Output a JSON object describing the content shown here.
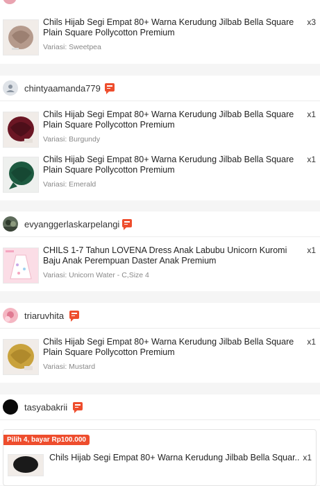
{
  "orders": [
    {
      "items": [
        {
          "title": "Chils Hijab Segi Empat 80+ Warna Kerudung Jilbab Bella Square Plain Square Pollycotton Premium",
          "qty": "x3",
          "variation": "Variasi: Sweetpea"
        }
      ]
    },
    {
      "username": "chintyaamanda779",
      "items": [
        {
          "title": "Chils Hijab Segi Empat 80+ Warna Kerudung Jilbab Bella Square Plain Square Pollycotton Premium",
          "qty": "x1",
          "variation": "Variasi: Burgundy"
        },
        {
          "title": "Chils Hijab Segi Empat 80+ Warna Kerudung Jilbab Bella Square Plain Square Pollycotton Premium",
          "qty": "x1",
          "variation": "Variasi: Emerald"
        }
      ]
    },
    {
      "username": "evyanggerlaskarpelangi",
      "items": [
        {
          "title": "CHILS 1-7 Tahun LOVENA Dress Anak Labubu Unicorn Kuromi Baju Anak Perempuan Daster Anak Premium",
          "qty": "x1",
          "variation": "Variasi: Unicorn Water - C,Size 4"
        }
      ]
    },
    {
      "username": "triaruvhita",
      "items": [
        {
          "title": "Chils Hijab Segi Empat 80+ Warna Kerudung Jilbab Bella Square Plain Square Pollycotton Premium",
          "qty": "x1",
          "variation": "Variasi: Mustard"
        }
      ]
    },
    {
      "username": "tasyabakrii",
      "promo": "Pilih 4, bayar Rp100.000",
      "items": [
        {
          "title": "Chils Hijab Segi Empat 80+ Warna Kerudung Jilbab Bella Squar...",
          "qty": "x1"
        }
      ]
    }
  ],
  "colors": {
    "accent": "#ee4d2d",
    "hijab_sweetpea": "#b59a8c",
    "hijab_burgundy": "#6b1624",
    "hijab_emerald": "#1d5a40",
    "hijab_mustard": "#c9a23c"
  },
  "icons": [
    "user-placeholder-icon",
    "chat-icon"
  ]
}
